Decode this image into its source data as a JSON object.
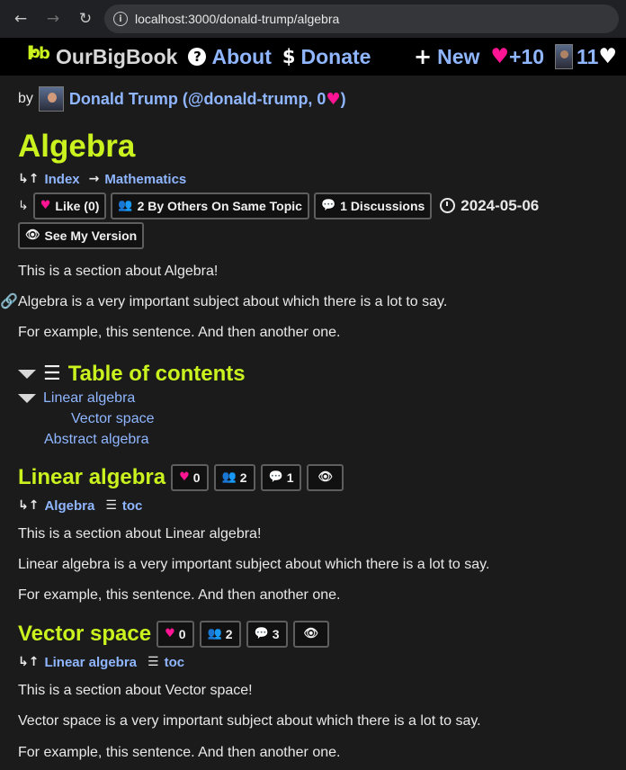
{
  "browser": {
    "back_glyph": "←",
    "forward_glyph": "→",
    "reload_glyph": "↻",
    "url": "localhost:3000/donald-trump/algebra"
  },
  "navbar": {
    "brand": "OurBigBook",
    "about": "About",
    "donate": "Donate",
    "new": "New",
    "score": "+10",
    "user_score": "11"
  },
  "page": {
    "by_label": "by",
    "author": "Donald Trump (@donald-trump, 0",
    "author_suffix": ")",
    "title": "Algebra",
    "breadcrumb": {
      "index": "Index",
      "parent": "Mathematics"
    },
    "actions": {
      "like": "Like (0)",
      "others": "2 By Others On Same Topic",
      "discussions": "1 Discussions",
      "date": "2024-05-06",
      "see_version": "See My Version"
    },
    "paragraphs": [
      "This is a section about Algebra!",
      "Algebra is a very important subject about which there is a lot to say.",
      "For example, this sentence. And then another one."
    ],
    "toc": {
      "title": "Table of contents",
      "items": [
        "Linear algebra",
        "Vector space",
        "Abstract algebra"
      ]
    }
  },
  "sections": [
    {
      "title": "Linear algebra",
      "likes": "0",
      "others": "2",
      "discussions": "1",
      "parent": "Algebra",
      "toc": "toc",
      "paragraphs": [
        "This is a section about Linear algebra!",
        "Linear algebra is a very important subject about which there is a lot to say.",
        "For example, this sentence. And then another one."
      ]
    },
    {
      "title": "Vector space",
      "likes": "0",
      "others": "2",
      "discussions": "3",
      "parent": "Linear algebra",
      "toc": "toc",
      "paragraphs": [
        "This is a section about Vector space!",
        "Vector space is a very important subject about which there is a lot to say.",
        "For example, this sentence. And then another one."
      ]
    }
  ],
  "colors": {
    "accent_heading": "#c9f21e",
    "link": "#8fb6ff",
    "heart": "#ff1493",
    "background": "#1b1b1b"
  }
}
